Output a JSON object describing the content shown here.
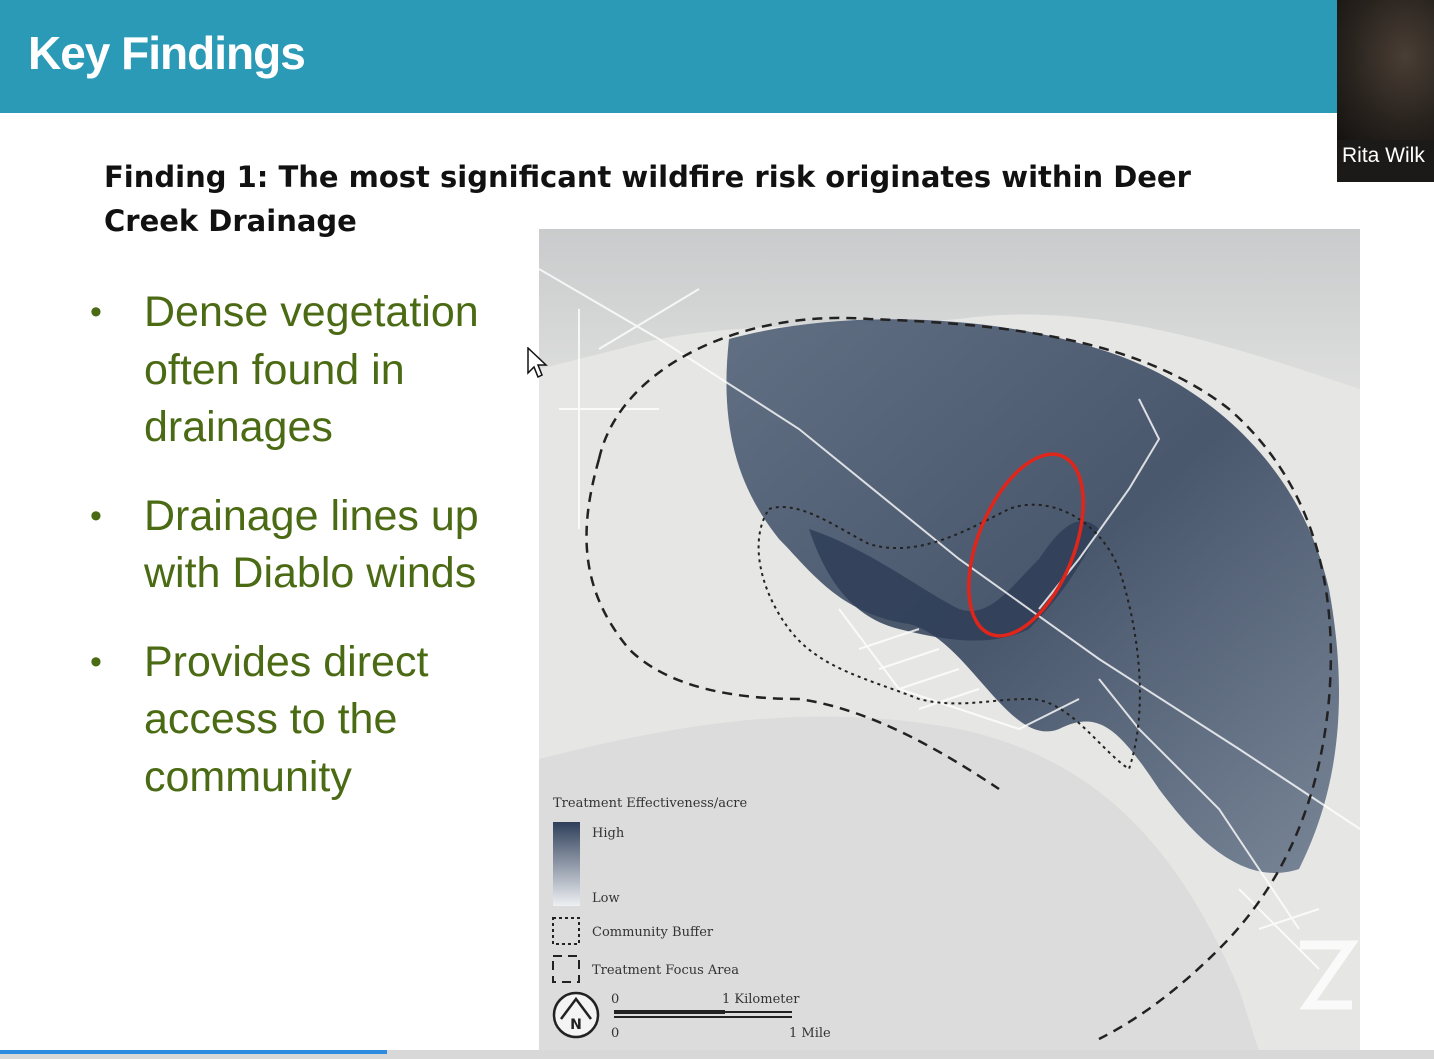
{
  "header": {
    "title": "Key Findings",
    "bg_color": "#2a9ab7"
  },
  "participant": {
    "name": "Rita Wilk"
  },
  "finding": {
    "title": "Finding 1: The most significant wildfire risk originates within Deer Creek Drainage"
  },
  "bullets": [
    {
      "text": "Dense vegetation often found in drainages"
    },
    {
      "text": "Drainage lines up with Diablo winds"
    },
    {
      "text": "Provides direct access to the community"
    }
  ],
  "map": {
    "legend": {
      "title": "Treatment Effectiveness/acre",
      "high": "High",
      "low": "Low",
      "community_buffer": "Community Buffer",
      "treatment_focus_area": "Treatment Focus Area"
    },
    "scale": {
      "km_zero": "0",
      "km_label": "1 Kilometer",
      "mile_zero": "0",
      "mile_label": "1 Mile"
    },
    "north_label": "N",
    "highlight_color": "#e0251b"
  },
  "progress": {
    "fraction": 0.27
  },
  "colors": {
    "bullet_text": "#4b6a14",
    "accent": "#2a9ab7"
  },
  "icons": {
    "north_arrow": "north-arrow-icon",
    "cursor": "mouse-cursor-icon",
    "zoom_watermark": "zoom-watermark-icon"
  }
}
